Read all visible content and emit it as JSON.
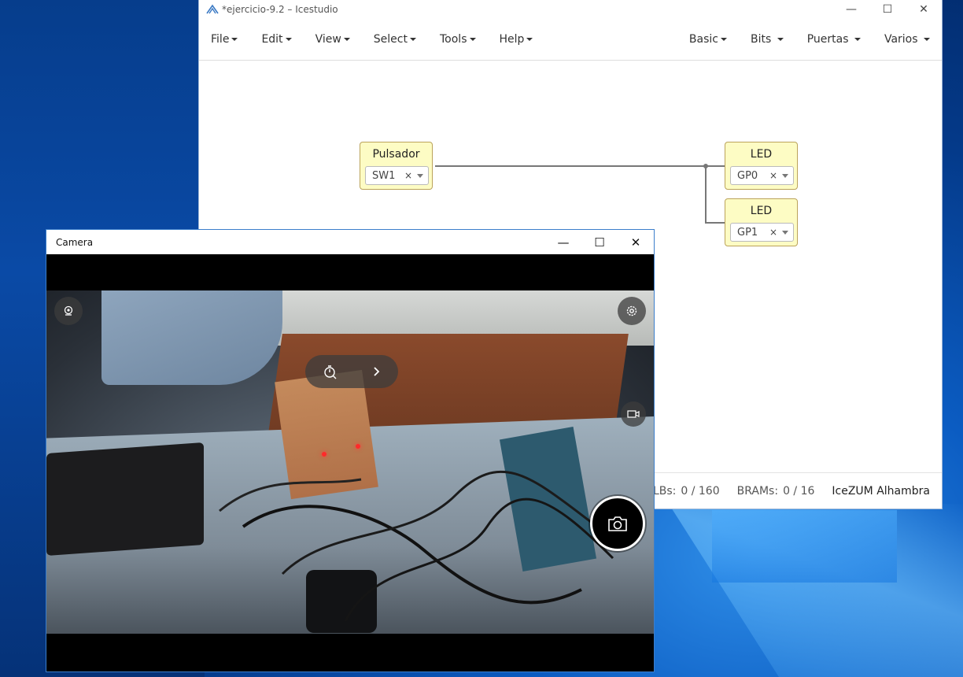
{
  "icestudio": {
    "title": "*ejercicio-9.2 – Icestudio",
    "menu_left": [
      "File",
      "Edit",
      "View",
      "Select",
      "Tools",
      "Help"
    ],
    "menu_right": [
      "Basic",
      "Bits",
      "Puertas",
      "Varios"
    ],
    "blocks": {
      "pulsador": {
        "name": "Pulsador",
        "value": "SW1",
        "clear": "×"
      },
      "led0": {
        "name": "LED",
        "value": "GP0",
        "clear": "×"
      },
      "led1": {
        "name": "LED",
        "value": "GP1",
        "clear": "×"
      }
    },
    "footer": {
      "plbs_label": "PLBs:",
      "plbs_value": "0 / 160",
      "brams_label": "BRAMs:",
      "brams_value": "0 / 16",
      "board": "IceZUM Alhambra"
    },
    "block_fill": "#fdfcc4",
    "block_border": "#bba35a"
  },
  "camera": {
    "title": "Camera",
    "icons": [
      "hdr-icon",
      "timer-icon",
      "chevron-right-icon",
      "settings-icon",
      "video-mode-icon",
      "camera-shutter-icon",
      "last-photo-thumbnail"
    ],
    "accent": "#3b7ecb"
  },
  "window_controls": {
    "minimize": "—",
    "maximize": "☐",
    "close": "✕"
  }
}
